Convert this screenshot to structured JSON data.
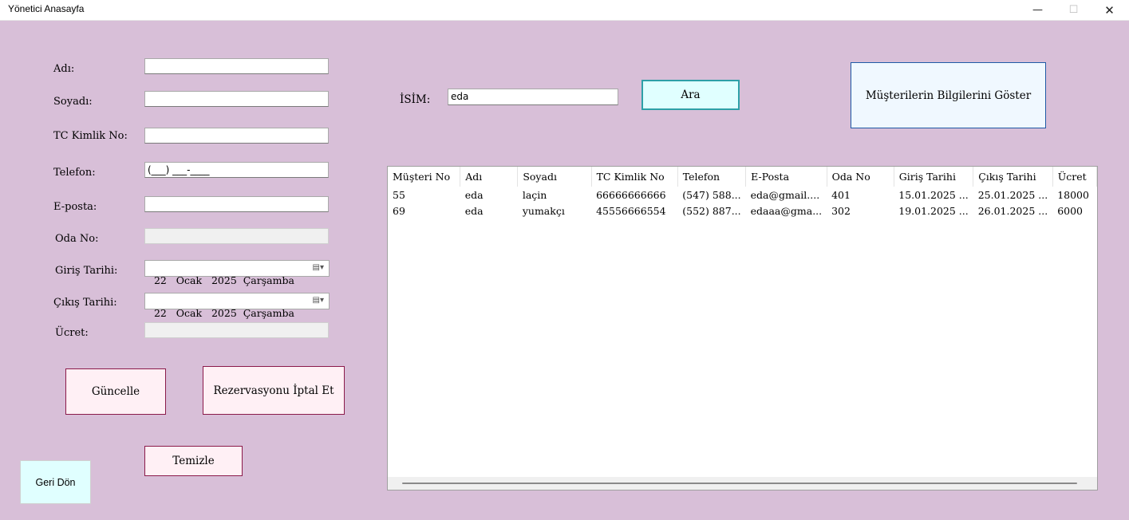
{
  "window": {
    "title": "Yönetici Anasayfa",
    "minimize": "—",
    "maximize": "☐",
    "close": "✕"
  },
  "form": {
    "labels": {
      "ad": "Adı:",
      "soyad": "Soyadı:",
      "tc": "TC Kimlik No:",
      "telefon": "Telefon:",
      "eposta": "E-posta:",
      "oda": "Oda No:",
      "giris": "Giriş Tarihi:",
      "cikis": "Çıkış Tarihi:",
      "ucret": "Ücret:"
    },
    "values": {
      "ad": "",
      "soyad": "",
      "tc": "",
      "telefon": "(___) ___-____",
      "eposta": "",
      "oda": "",
      "giris": "22   Ocak   2025  Çarşamba",
      "cikis": "22   Ocak   2025  Çarşamba",
      "ucret": ""
    },
    "calendar_icon": "calendar-dropdown-icon"
  },
  "buttons": {
    "guncelle": "Güncelle",
    "iptal": "Rezervasyonu İptal Et",
    "temizle": "Temizle",
    "geri": "Geri Dön",
    "ara": "Ara",
    "goster": "Müşterilerin Bilgilerini Göster"
  },
  "search": {
    "label": "İSİM:",
    "value": "eda"
  },
  "grid": {
    "columns": [
      "Müşteri No",
      "Adı",
      "Soyadı",
      "TC Kimlik No",
      "Telefon",
      "E-Posta",
      "Oda No",
      "Giriş Tarihi",
      "Çıkış Tarihi",
      "Ücret"
    ],
    "rows": [
      [
        "55",
        "eda",
        "laçin",
        "66666666666",
        "(547) 588...",
        "eda@gmail....",
        "401",
        "15.01.2025 ...",
        "25.01.2025 ...",
        "18000"
      ],
      [
        "69",
        "eda",
        "yumakçı",
        "45556666554",
        "(552) 887...",
        "edaaa@gma...",
        "302",
        "19.01.2025 ...",
        "26.01.2025 ...",
        "6000"
      ]
    ]
  },
  "colors": {
    "background": "#d8bfd8",
    "pink_button": "#fff0f5",
    "cyan_button": "#e0ffff",
    "blue_button": "#f0f8ff"
  }
}
